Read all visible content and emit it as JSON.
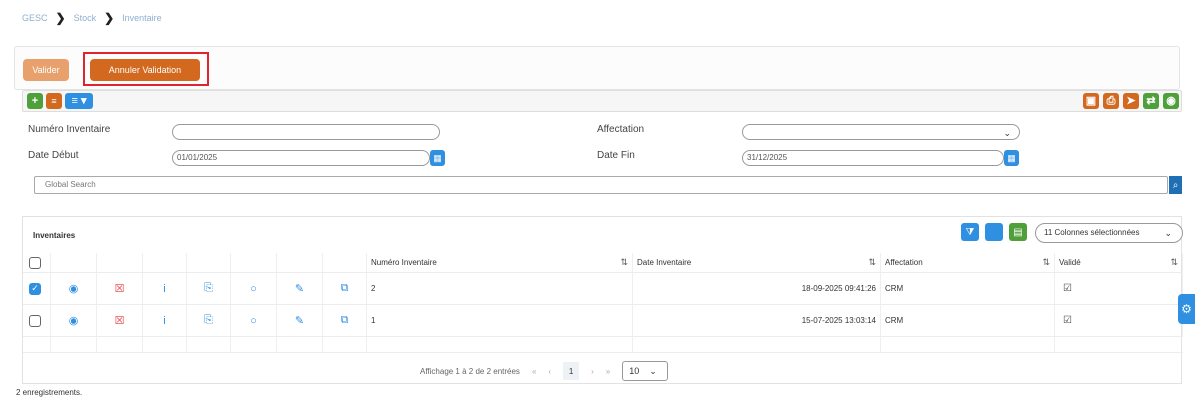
{
  "breadcrumb": {
    "items": [
      "GESC",
      "Stock",
      "Inventaire"
    ]
  },
  "actions": {
    "valider": "Valider",
    "annuler": "Annuler Validation"
  },
  "filters": {
    "numero_label": "Numéro Inventaire",
    "numero_value": "",
    "affectation_label": "Affectation",
    "affectation_value": "",
    "date_debut_label": "Date Début",
    "date_debut_value": "01/01/2025",
    "date_fin_label": "Date Fin",
    "date_fin_value": "31/12/2025",
    "global_search_placeholder": "Global Search"
  },
  "table": {
    "title": "Inventaires",
    "column_selector": "11 Colonnes sélectionnées",
    "headers": {
      "numero": "Numéro Inventaire",
      "date": "Date Inventaire",
      "affectation": "Affectation",
      "valide": "Validé"
    },
    "rows": [
      {
        "selected": true,
        "numero": "2",
        "date": "18-09-2025 09:41:26",
        "affectation": "CRM"
      },
      {
        "selected": false,
        "numero": "1",
        "date": "15-07-2025 13:03:14",
        "affectation": "CRM"
      }
    ]
  },
  "pagination": {
    "summary": "Affichage 1 à 2 de 2 entrées",
    "page": "1",
    "page_size": "10"
  },
  "footer": {
    "count": "2 enregistrements."
  },
  "colors": {
    "orange": "#d2691e",
    "light_orange": "#e8a16c",
    "blue": "#2f8fe0",
    "green": "#4f9f3a",
    "highlight": "#e0242f"
  }
}
